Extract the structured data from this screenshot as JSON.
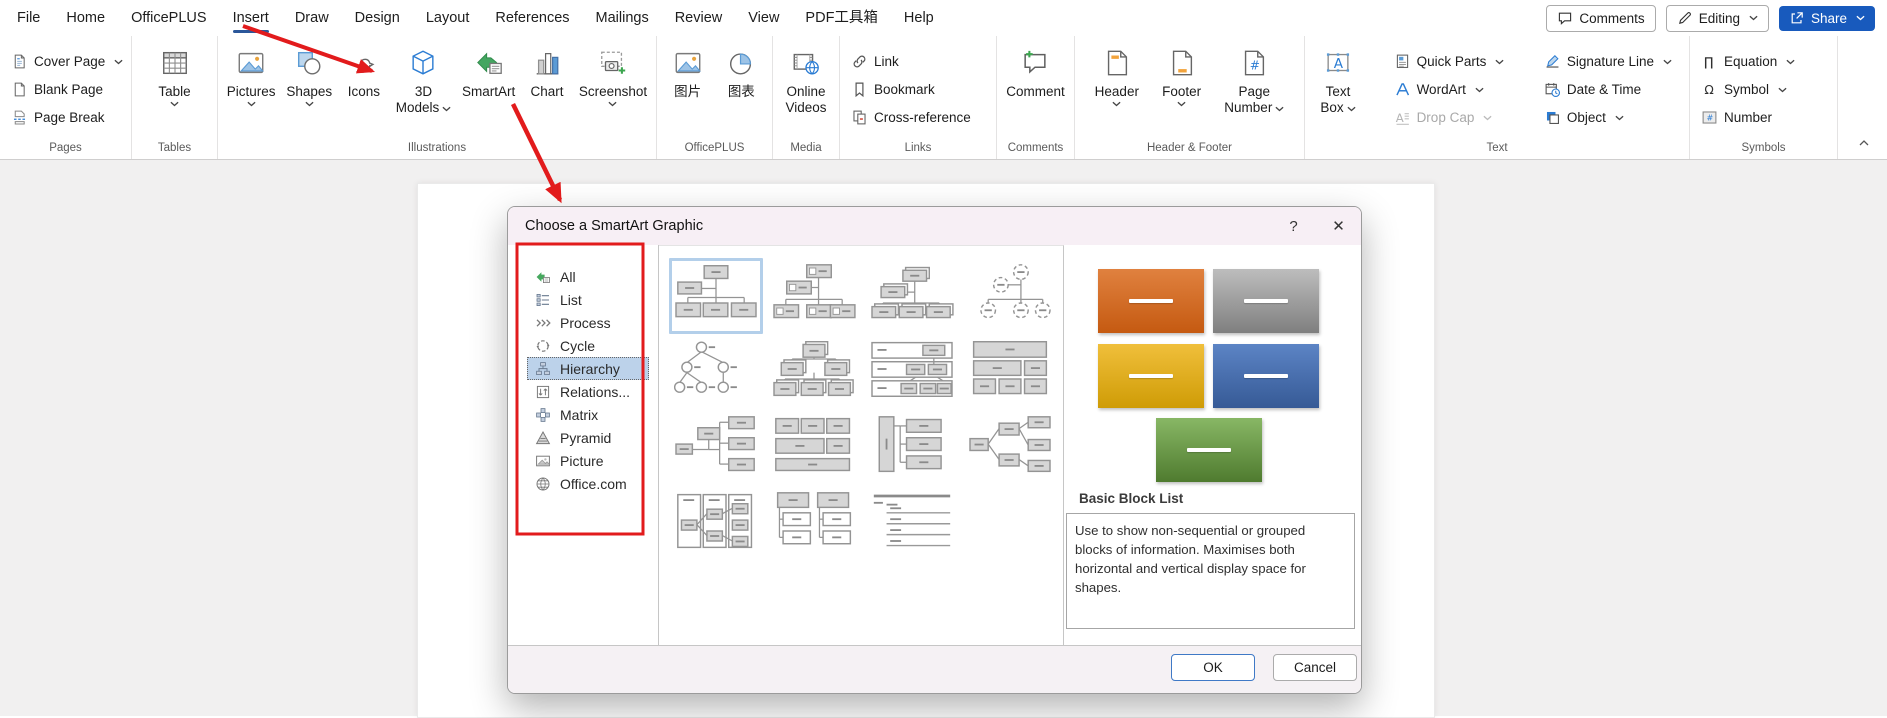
{
  "menu_bar": {
    "items": [
      {
        "label": "File"
      },
      {
        "label": "Home"
      },
      {
        "label": "OfficePLUS"
      },
      {
        "label": "Insert",
        "active": true
      },
      {
        "label": "Draw"
      },
      {
        "label": "Design"
      },
      {
        "label": "Layout"
      },
      {
        "label": "References"
      },
      {
        "label": "Mailings"
      },
      {
        "label": "Review"
      },
      {
        "label": "View"
      },
      {
        "label": "PDF工具箱"
      },
      {
        "label": "Help"
      }
    ],
    "right": {
      "comments_label": "Comments",
      "editing_label": "Editing",
      "share_label": "Share",
      "share_color": "#185abd"
    }
  },
  "ribbon": {
    "groups": [
      {
        "name": "Pages",
        "layout": "stack",
        "items": [
          {
            "label": "Cover Page",
            "icon": "cover-page",
            "chevron": true
          },
          {
            "label": "Blank Page",
            "icon": "blank-page"
          },
          {
            "label": "Page Break",
            "icon": "page-break"
          }
        ]
      },
      {
        "name": "Tables",
        "layout": "big",
        "items": [
          {
            "label": "Table",
            "icon": "table",
            "chevron": true
          }
        ]
      },
      {
        "name": "Illustrations",
        "layout": "big",
        "items": [
          {
            "label": "Pictures",
            "icon": "pictures",
            "chevron": true
          },
          {
            "label": "Shapes",
            "icon": "shapes",
            "chevron": true
          },
          {
            "label": "Icons",
            "icon": "icons"
          },
          {
            "label": "3D Models",
            "icon": "3d-models",
            "chevron": true,
            "two_line": true
          },
          {
            "label": "SmartArt",
            "icon": "smartart"
          },
          {
            "label": "Chart",
            "icon": "chart"
          },
          {
            "label": "Screenshot",
            "icon": "screenshot",
            "chevron": true
          }
        ]
      },
      {
        "name": "OfficePLUS",
        "layout": "big",
        "items": [
          {
            "label": "图片",
            "icon": "cn-picture"
          },
          {
            "label": "图表",
            "icon": "cn-chart"
          }
        ]
      },
      {
        "name": "Media",
        "layout": "big",
        "items": [
          {
            "label": "Online Videos",
            "icon": "online-videos",
            "two_line": true
          }
        ]
      },
      {
        "name": "Links",
        "layout": "stack",
        "items": [
          {
            "label": "Link",
            "icon": "link"
          },
          {
            "label": "Bookmark",
            "icon": "bookmark"
          },
          {
            "label": "Cross-reference",
            "icon": "cross-reference"
          }
        ]
      },
      {
        "name": "Comments",
        "layout": "big",
        "items": [
          {
            "label": "Comment",
            "icon": "comment"
          }
        ]
      },
      {
        "name": "Header & Footer",
        "layout": "big",
        "items": [
          {
            "label": "Header",
            "icon": "header",
            "chevron": true
          },
          {
            "label": "Footer",
            "icon": "footer",
            "chevron": true
          },
          {
            "label": "Page Number",
            "icon": "page-number",
            "chevron": true,
            "two_line": true
          }
        ]
      },
      {
        "name": "Text",
        "layout": "mixed",
        "big": [
          {
            "label": "Text Box",
            "icon": "text-box",
            "chevron": true,
            "two_line": true
          }
        ],
        "columns": [
          [
            {
              "label": "Quick Parts",
              "icon": "quick-parts",
              "chevron": true
            },
            {
              "label": "WordArt",
              "icon": "wordart",
              "chevron": true
            },
            {
              "label": "Drop Cap",
              "icon": "drop-cap",
              "chevron": true,
              "disabled": true
            }
          ],
          [
            {
              "label": "Signature Line",
              "icon": "signature-line",
              "chevron": true
            },
            {
              "label": "Date & Time",
              "icon": "date-time"
            },
            {
              "label": "Object",
              "icon": "object",
              "chevron": true
            }
          ]
        ]
      },
      {
        "name": "Symbols",
        "layout": "stack",
        "items": [
          {
            "label": "Equation",
            "icon": "equation",
            "chevron": true
          },
          {
            "label": "Symbol",
            "icon": "symbol",
            "chevron": true
          },
          {
            "label": "Number",
            "icon": "number"
          }
        ]
      }
    ]
  },
  "dialog": {
    "title": "Choose a SmartArt Graphic",
    "help_label": "?",
    "close_label": "✕",
    "categories": [
      {
        "label": "All",
        "icon": "cat-all"
      },
      {
        "label": "List",
        "icon": "cat-list"
      },
      {
        "label": "Process",
        "icon": "cat-process"
      },
      {
        "label": "Cycle",
        "icon": "cat-cycle"
      },
      {
        "label": "Hierarchy",
        "icon": "cat-hierarchy",
        "selected": true
      },
      {
        "label": "Relations...",
        "icon": "cat-relationship"
      },
      {
        "label": "Matrix",
        "icon": "cat-matrix"
      },
      {
        "label": "Pyramid",
        "icon": "cat-pyramid"
      },
      {
        "label": "Picture",
        "icon": "cat-picture"
      },
      {
        "label": "Office.com",
        "icon": "cat-office"
      }
    ],
    "gallery": {
      "items": [
        {
          "kind": "organization-chart",
          "selected": true
        },
        {
          "kind": "name-title-organization-chart"
        },
        {
          "kind": "half-circle-organization-chart"
        },
        {
          "kind": "circle-picture-hierarchy"
        },
        {
          "kind": "hierarchy-circles"
        },
        {
          "kind": "labeled-hierarchy"
        },
        {
          "kind": "table-hierarchy-rows"
        },
        {
          "kind": "table-hierarchy-blocks"
        },
        {
          "kind": "horizontal-organization-chart"
        },
        {
          "kind": "block-hierarchy-grid"
        },
        {
          "kind": "vertical-accent-list"
        },
        {
          "kind": "horizontal-hierarchy"
        },
        {
          "kind": "column-hierarchy"
        },
        {
          "kind": "architecture-layout"
        },
        {
          "kind": "lined-list"
        }
      ]
    },
    "preview": {
      "title": "Basic Block List",
      "description": "Use to show non-sequential or grouped blocks of information. Maximises both horizontal and vertical display space for shapes.",
      "blocks": [
        {
          "name": "orange-block",
          "from": "#e0813f",
          "to": "#c55a11"
        },
        {
          "name": "gray-block",
          "from": "#bdbdbd",
          "to": "#7f7f7f"
        },
        {
          "name": "gold-block",
          "from": "#f0bf3b",
          "to": "#cf9c06"
        },
        {
          "name": "blue-block",
          "from": "#5c84c5",
          "to": "#365a96"
        },
        {
          "name": "green-block",
          "from": "#88b765",
          "to": "#4f7b2f"
        }
      ]
    },
    "buttons": {
      "ok_label": "OK",
      "cancel_label": "Cancel"
    }
  },
  "annotations": {
    "color": "#e21b1c"
  }
}
